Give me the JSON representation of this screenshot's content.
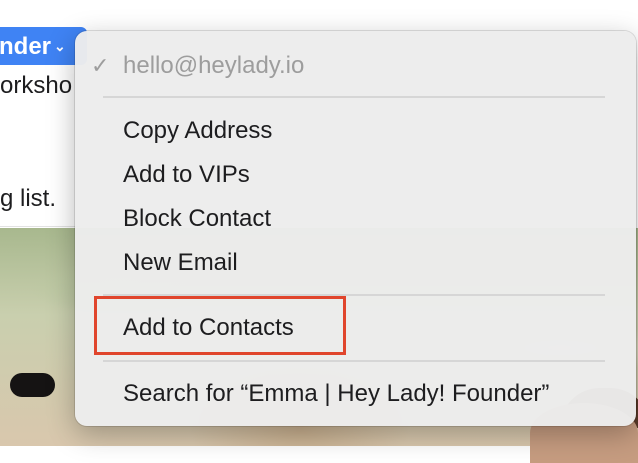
{
  "background": {
    "sender_chip": "nder",
    "line1": "orksho",
    "line2": "g list."
  },
  "menu": {
    "email": "hello@heylady.io",
    "items": [
      {
        "label": "Copy Address"
      },
      {
        "label": "Add to VIPs"
      },
      {
        "label": "Block Contact"
      },
      {
        "label": "New Email"
      },
      {
        "label": "Add to Contacts"
      },
      {
        "label": "Search for “Emma | Hey Lady! Founder”"
      }
    ]
  },
  "colors": {
    "accent": "#3f83f4",
    "highlight": "#e0452c"
  },
  "icons": {
    "check": "checkmark-icon",
    "chevron": "chevron-down-icon"
  }
}
